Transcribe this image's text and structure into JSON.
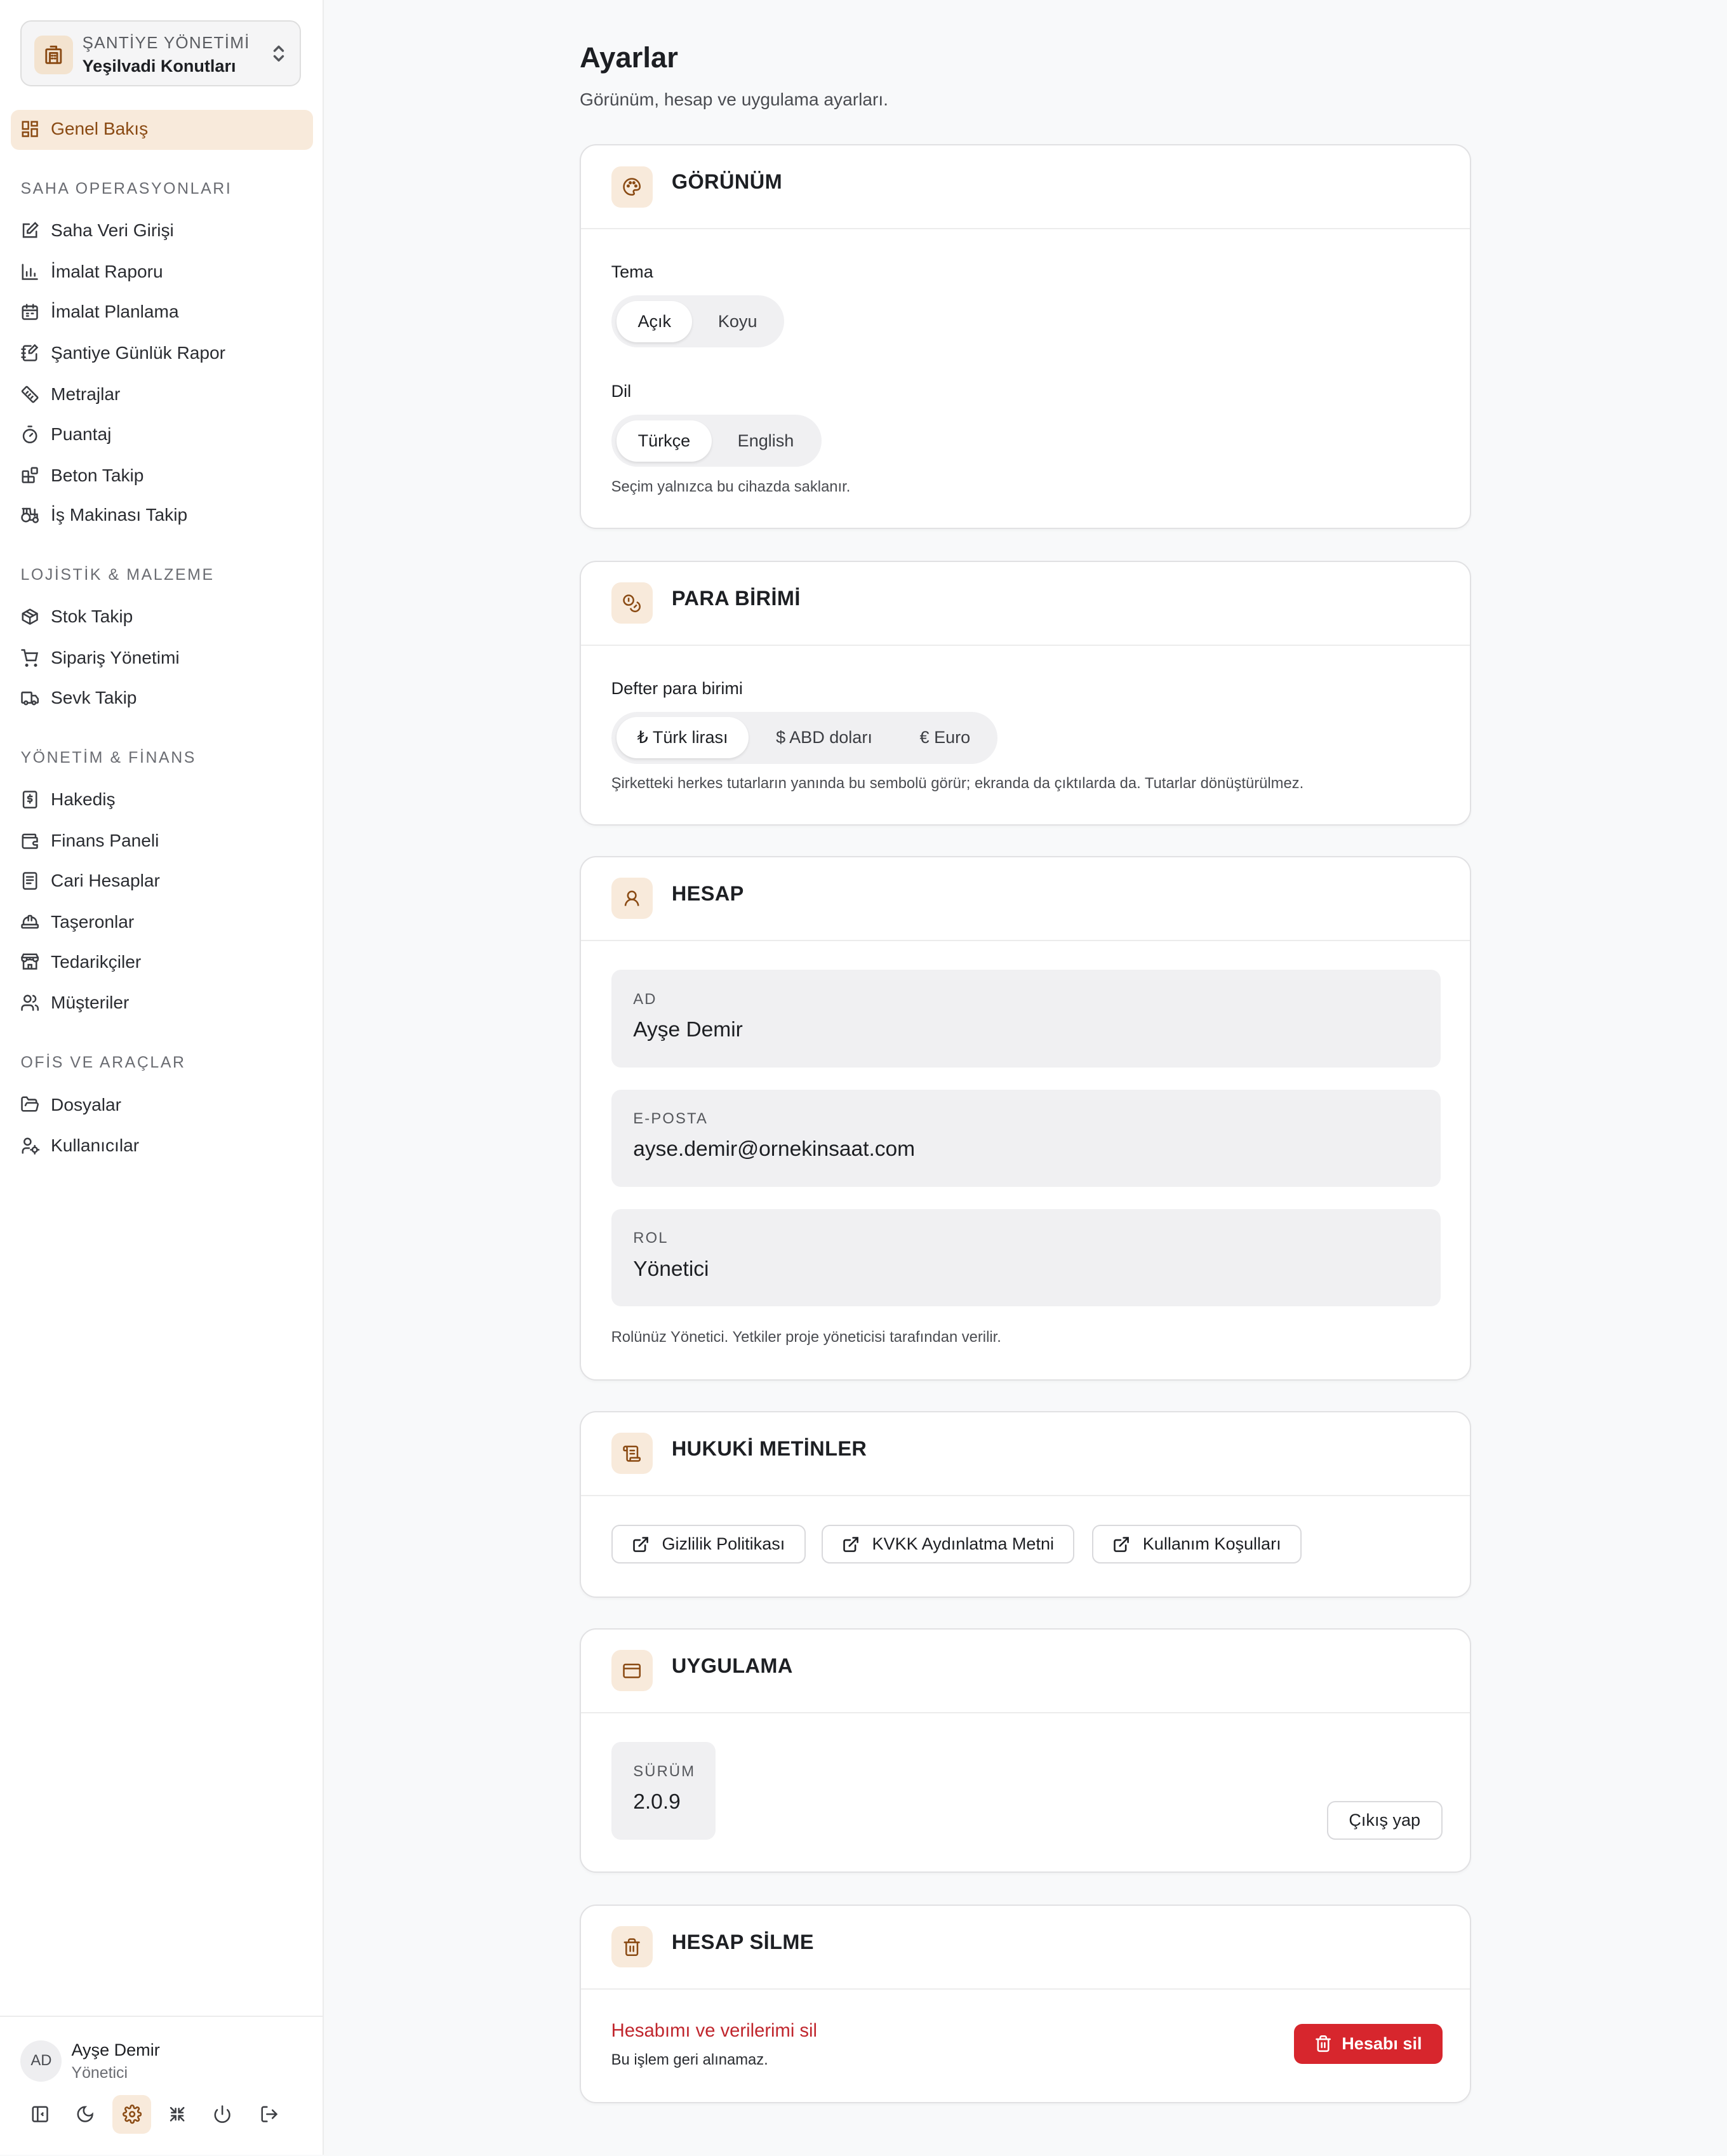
{
  "colors": {
    "accent": "#8a4a13",
    "accent_bg": "#f8eadb",
    "danger": "#d7262d",
    "page_bg": "#f8f9fa"
  },
  "workspace": {
    "label": "ŞANTİYE YÖNETİMİ",
    "project": "Yeşilvadi Konutları",
    "icon": "building-icon"
  },
  "sidebar": {
    "overview": {
      "label": "Genel Bakış",
      "icon": "layout-grid-icon"
    },
    "sections": [
      {
        "title": "SAHA OPERASYONLARI",
        "items": [
          {
            "label": "Saha Veri Girişi",
            "icon": "edit-icon"
          },
          {
            "label": "İmalat Raporu",
            "icon": "bar-chart-icon"
          },
          {
            "label": "İmalat Planlama",
            "icon": "calendar-icon"
          },
          {
            "label": "Şantiye Günlük Rapor",
            "icon": "notebook-pen-icon"
          },
          {
            "label": "Metrajlar",
            "icon": "ruler-icon"
          },
          {
            "label": "Puantaj",
            "icon": "timer-icon"
          },
          {
            "label": "Beton Takip",
            "icon": "blocks-icon"
          },
          {
            "label": "İş Makinası Takip",
            "icon": "tractor-icon"
          }
        ]
      },
      {
        "title": "LOJİSTİK & MALZEME",
        "items": [
          {
            "label": "Stok Takip",
            "icon": "package-icon"
          },
          {
            "label": "Sipariş Yönetimi",
            "icon": "cart-icon"
          },
          {
            "label": "Sevk Takip",
            "icon": "truck-icon"
          }
        ]
      },
      {
        "title": "YÖNETİM & FİNANS",
        "items": [
          {
            "label": "Hakediş",
            "icon": "receipt-icon"
          },
          {
            "label": "Finans Paneli",
            "icon": "wallet-icon"
          },
          {
            "label": "Cari Hesaplar",
            "icon": "ledger-icon"
          },
          {
            "label": "Taşeronlar",
            "icon": "hard-hat-icon"
          },
          {
            "label": "Tedarikçiler",
            "icon": "store-icon"
          },
          {
            "label": "Müşteriler",
            "icon": "users-icon"
          }
        ]
      },
      {
        "title": "OFİS VE ARAÇLAR",
        "items": [
          {
            "label": "Dosyalar",
            "icon": "folder-open-icon"
          },
          {
            "label": "Kullanıcılar",
            "icon": "user-cog-icon"
          }
        ]
      }
    ]
  },
  "user": {
    "initials": "AD",
    "name": "Ayşe Demir",
    "role": "Yönetici"
  },
  "footer_icons": [
    "sidebar-toggle-icon",
    "moon-icon",
    "gear-icon",
    "minimize-icon",
    "power-icon",
    "logout-icon"
  ],
  "page": {
    "title": "Ayarlar",
    "subtitle": "Görünüm, hesap ve uygulama ayarları."
  },
  "appearance": {
    "title": "GÖRÜNÜM",
    "icon": "palette-icon",
    "theme_label": "Tema",
    "theme_options": [
      "Açık",
      "Koyu"
    ],
    "theme_selected": "Açık",
    "lang_label": "Dil",
    "lang_options": [
      "Türkçe",
      "English"
    ],
    "lang_selected": "Türkçe",
    "hint": "Seçim yalnızca bu cihazda saklanır."
  },
  "currency": {
    "title": "PARA BİRİMİ",
    "icon": "coins-icon",
    "label": "Defter para birimi",
    "options": [
      "₺ Türk lirası",
      "$ ABD doları",
      "€ Euro"
    ],
    "selected": "₺ Türk lirası",
    "hint": "Şirketteki herkes tutarların yanında bu sembolü görür; ekranda da çıktılarda da. Tutarlar dönüştürülmez."
  },
  "account": {
    "title": "HESAP",
    "icon": "user-icon",
    "fields": [
      {
        "label": "AD",
        "value": "Ayşe Demir"
      },
      {
        "label": "E-POSTA",
        "value": "ayse.demir@ornekinsaat.com"
      },
      {
        "label": "ROL",
        "value": "Yönetici"
      }
    ],
    "hint": "Rolünüz Yönetici. Yetkiler proje yöneticisi tarafından verilir."
  },
  "legal": {
    "title": "HUKUKİ METİNLER",
    "icon": "scroll-icon",
    "links": [
      "Gizlilik Politikası",
      "KVKK Aydınlatma Metni",
      "Kullanım Koşulları"
    ]
  },
  "app": {
    "title": "UYGULAMA",
    "icon": "app-window-icon",
    "version_label": "SÜRÜM",
    "version": "2.0.9",
    "logout": "Çıkış yap"
  },
  "delete_account": {
    "title": "HESAP SİLME",
    "icon": "trash-icon",
    "heading": "Hesabımı ve verilerimi sil",
    "note": "Bu işlem geri alınamaz.",
    "button": "Hesabı sil"
  }
}
